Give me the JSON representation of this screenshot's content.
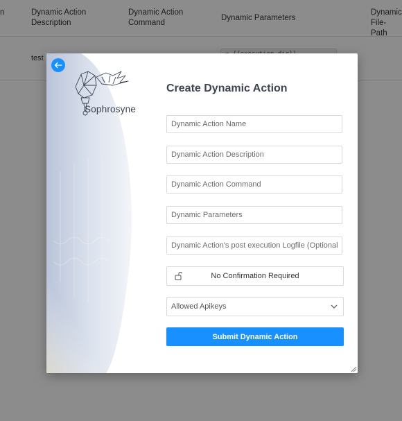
{
  "table": {
    "columns": [
      "n",
      "Dynamic Action\nDescription",
      "Dynamic Action\nCommand",
      "Dynamic Parameters",
      "Dynamic\nFile-Path"
    ],
    "row": {
      "description": "test",
      "parameters_snippet": "= {{execution_dir}}"
    }
  },
  "modal": {
    "brand": "Sophrosyne",
    "title": "Create Dynamic Action",
    "fields": {
      "name_placeholder": "Dynamic Action Name",
      "description_placeholder": "Dynamic Action Description",
      "command_placeholder": "Dynamic Action Command",
      "parameters_placeholder": "Dynamic Parameters",
      "logfile_placeholder": "Dynamic Action's post execution Logfile (Optional)"
    },
    "confirmation_label": "No Confirmation Required",
    "apikeys_label": "Allowed Apikeys",
    "submit_label": "Submit Dynamic Action"
  },
  "colors": {
    "accent": "#1890ff",
    "overlay": "rgba(0,0,0,0.45)",
    "title": "#3f4550"
  },
  "icons": [
    "arrow-left-icon",
    "torch-logo",
    "unlock-icon",
    "chevron-down-icon",
    "resize-handle-icon"
  ]
}
